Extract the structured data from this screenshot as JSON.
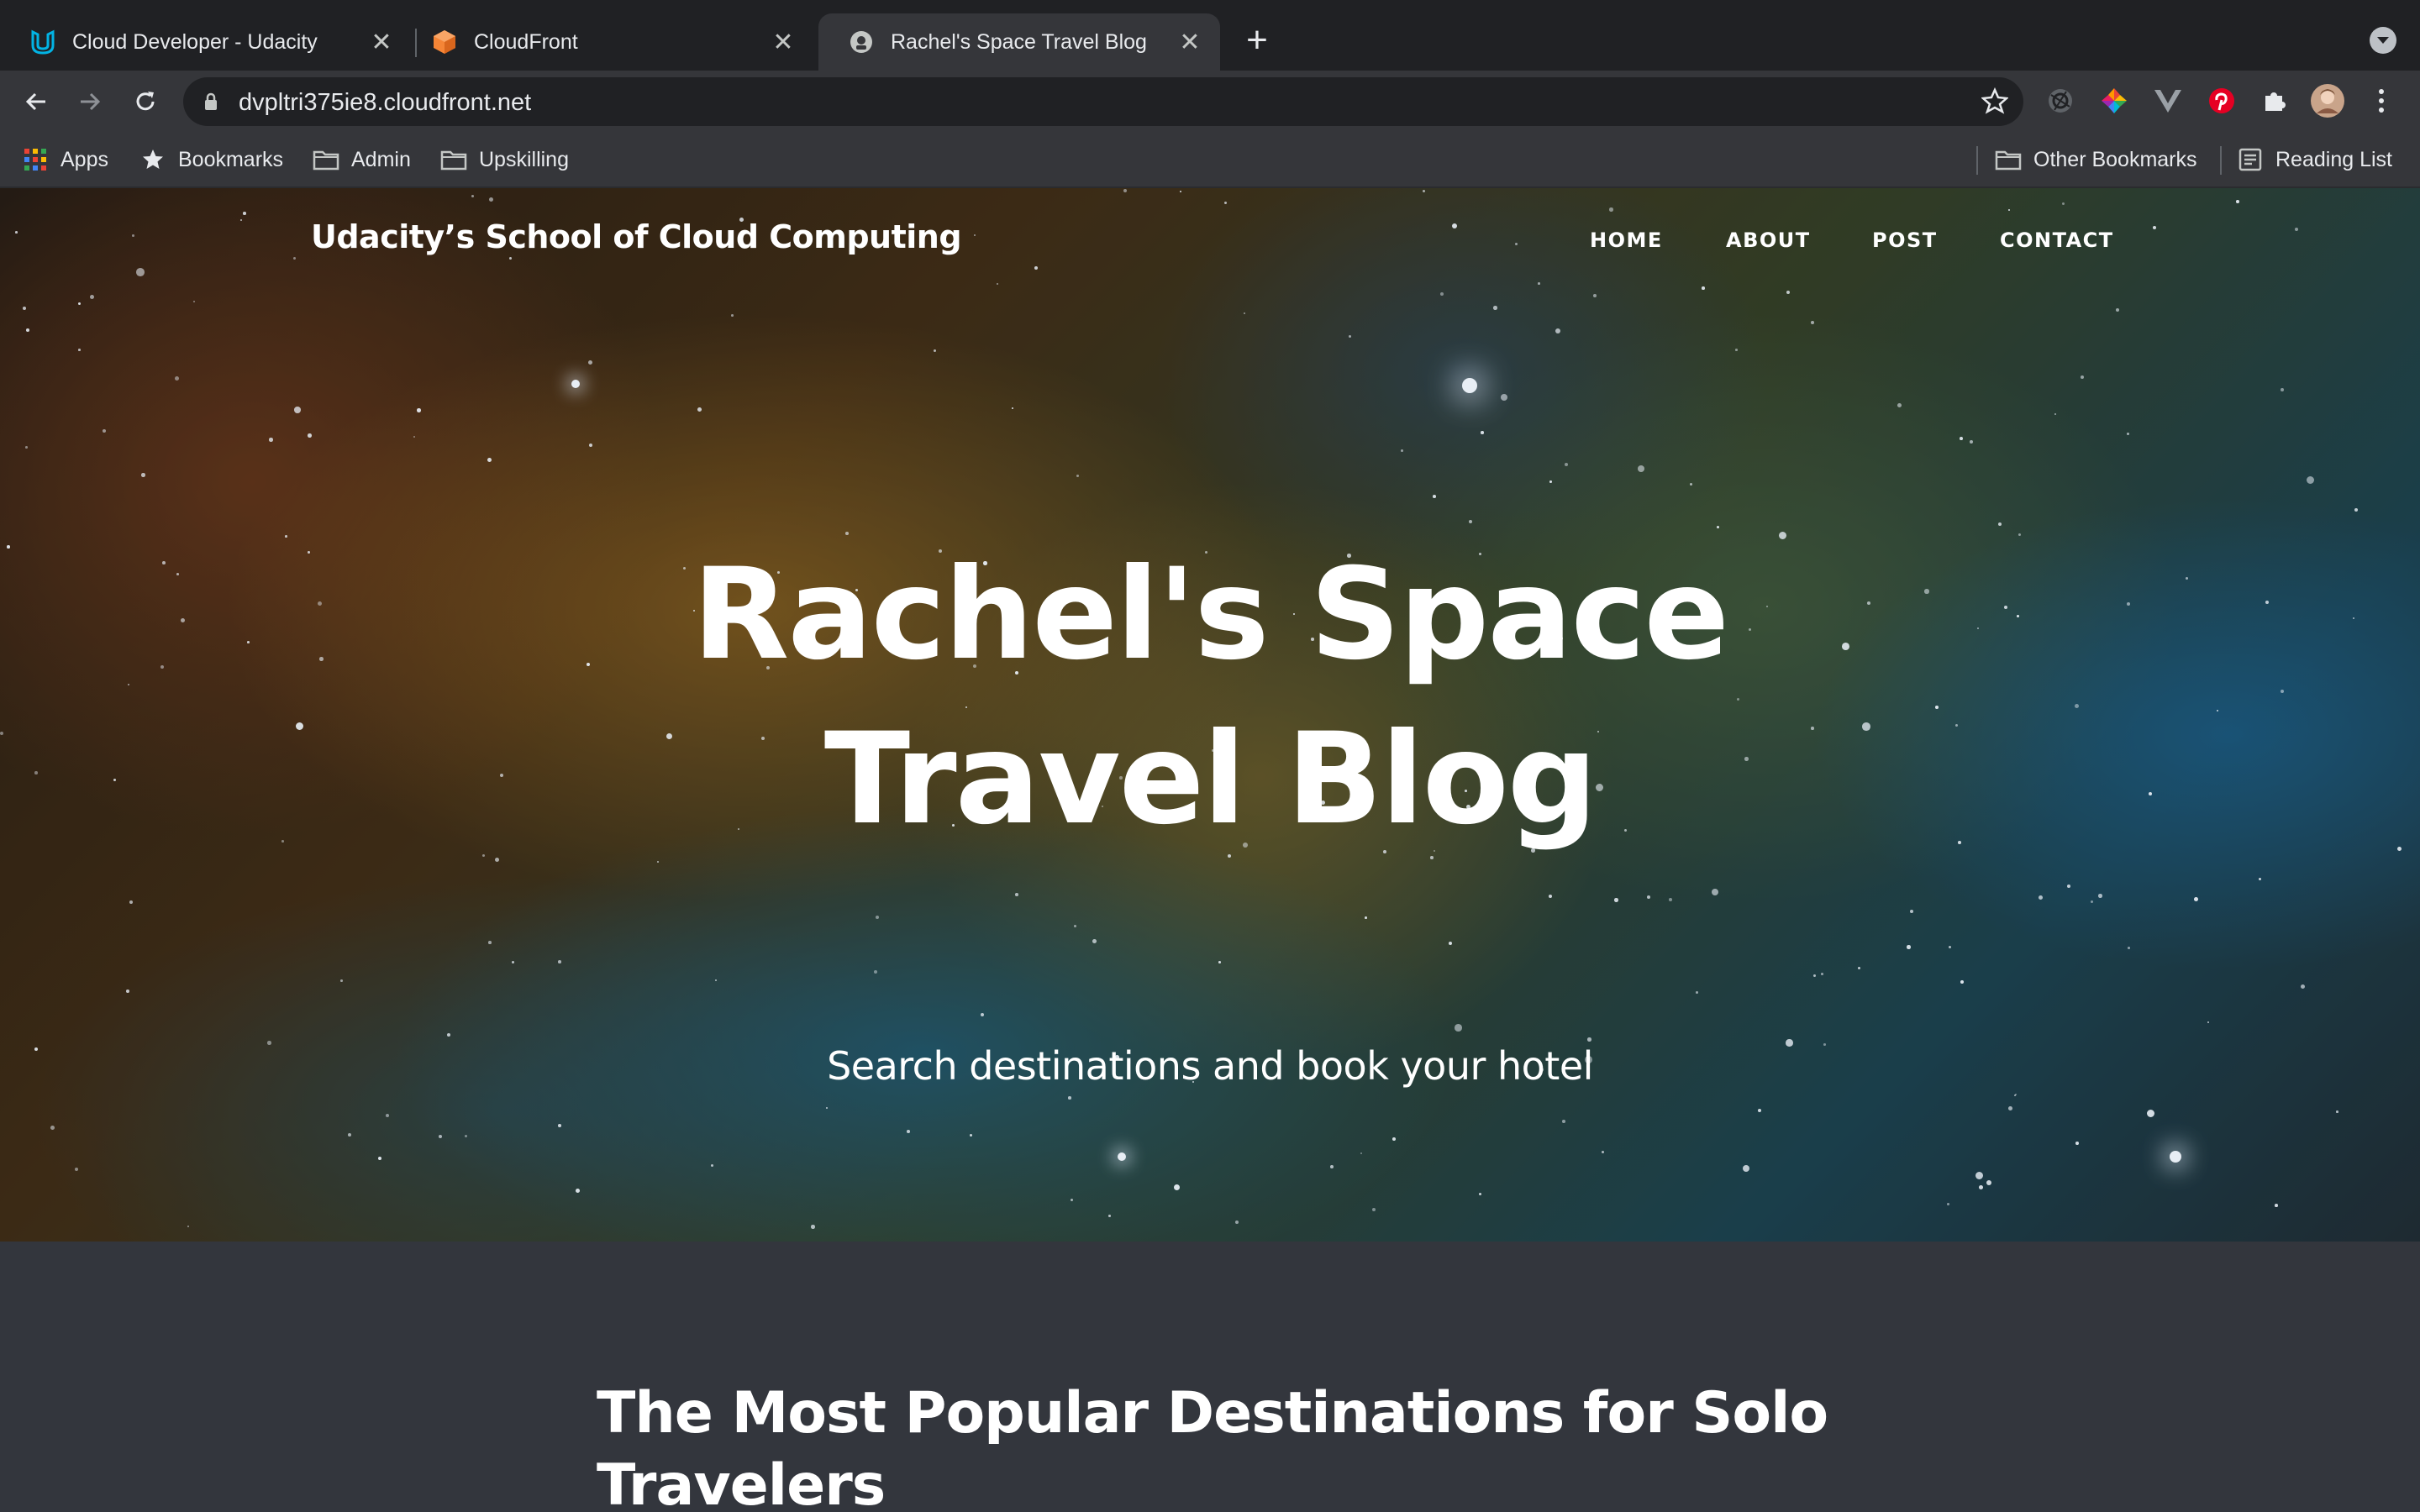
{
  "browser": {
    "tabs": [
      {
        "title": "Cloud Developer - Udacity",
        "active": false
      },
      {
        "title": "CloudFront",
        "active": false
      },
      {
        "title": "Rachel's Space Travel Blog",
        "active": true
      }
    ],
    "address": "dvpltri375ie8.cloudfront.net",
    "bookmarks": [
      {
        "label": "Apps",
        "icon": "apps-grid-icon"
      },
      {
        "label": "Bookmarks",
        "icon": "star-icon"
      },
      {
        "label": "Admin",
        "icon": "folder-icon"
      },
      {
        "label": "Upskilling",
        "icon": "folder-icon"
      }
    ],
    "bookmarks_right": [
      {
        "label": "Other Bookmarks",
        "icon": "folder-icon"
      },
      {
        "label": "Reading List",
        "icon": "reading-list-icon"
      }
    ]
  },
  "site": {
    "brand": "Udacity’s School of Cloud Computing",
    "nav": [
      "HOME",
      "ABOUT",
      "POST",
      "CONTACT"
    ],
    "hero": {
      "title_line1": "Rachel's Space",
      "title_line2": "Travel Blog",
      "subtitle": "Search destinations and book your hotel"
    },
    "post": {
      "title": "The Most Popular Destinations for Solo Travelers"
    }
  },
  "colors": {
    "chrome_dark": "#202124",
    "chrome_toolbar": "#35363a",
    "content_bg": "#33363d",
    "udacity_blue": "#02b3e4",
    "cloudfront_orange": "#f58536"
  }
}
